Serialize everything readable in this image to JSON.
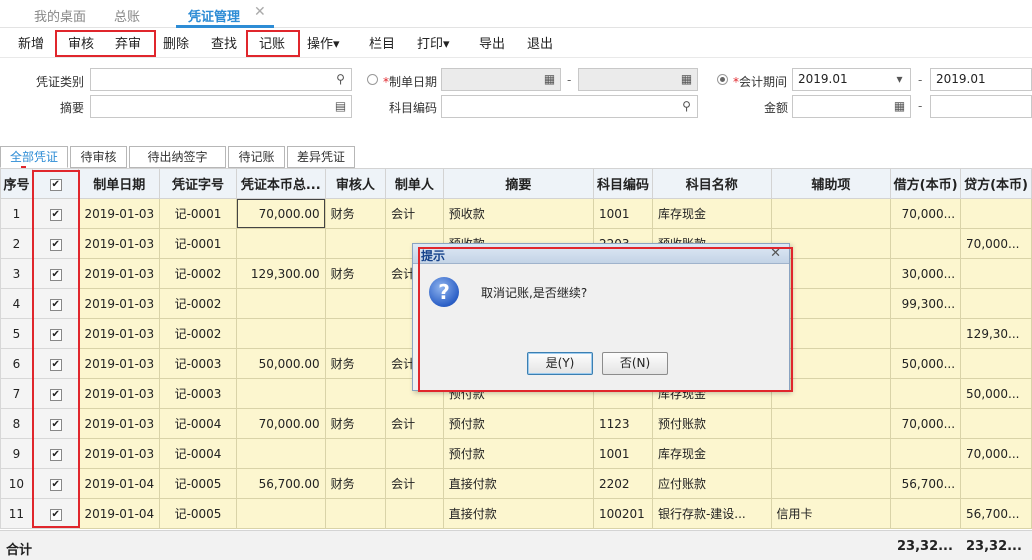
{
  "tabs": [
    {
      "label": "我的桌面"
    },
    {
      "label": "总账"
    },
    {
      "label": "凭证管理",
      "active": true
    }
  ],
  "tab_close": "✕",
  "toolbar": {
    "add": "新增",
    "audit": "审核",
    "unaudit": "弃审",
    "delete": "删除",
    "find": "查找",
    "post": "记账",
    "operate": "操作",
    "columns": "栏目",
    "print": "打印",
    "export": "导出",
    "exit": "退出",
    "caret": "▾"
  },
  "filters": {
    "voucher_type_label": "凭证类别",
    "voucher_type_value": "",
    "summary_label": "摘要",
    "summary_value": "",
    "make_date_label": "制单日期",
    "make_date_from": "",
    "make_date_to": "",
    "account_code_label": "科目编码",
    "account_code_value": "",
    "period_label": "会计期间",
    "period_from": "2019.01",
    "period_to": "2019.01",
    "amount_label": "金额",
    "amount_from": "",
    "amount_to": "",
    "period_selected": true,
    "required_mark": "*",
    "range_dash": "-"
  },
  "filter_tabs": [
    "全部凭证",
    "待审核",
    "待出纳签字",
    "待记账",
    "差异凭证"
  ],
  "grid": {
    "columns": [
      "序号",
      "",
      "制单日期",
      "凭证字号",
      "凭证本币总...",
      "审核人",
      "制单人",
      "摘要",
      "科目编码",
      "科目名称",
      "辅助项",
      "借方(本币)",
      "贷方(本币)"
    ],
    "rows": [
      {
        "seq": "1",
        "checked": true,
        "date": "2019-01-03",
        "no": "记-0001",
        "total": "70,000.00",
        "auditor": "财务",
        "maker": "会计",
        "summary": "预收款",
        "code": "1001",
        "name": "库存现金",
        "aux": "",
        "debit": "70,000...",
        "credit": ""
      },
      {
        "seq": "2",
        "checked": true,
        "date": "2019-01-03",
        "no": "记-0001",
        "total": "",
        "auditor": "",
        "maker": "",
        "summary": "预收款",
        "code": "2203",
        "name": "预收账款",
        "aux": "",
        "debit": "",
        "credit": "70,000..."
      },
      {
        "seq": "3",
        "checked": true,
        "date": "2019-01-03",
        "no": "记-0002",
        "total": "129,300.00",
        "auditor": "财务",
        "maker": "会计",
        "summary": "",
        "code": "",
        "name": "",
        "aux": "款",
        "debit": "30,000...",
        "credit": ""
      },
      {
        "seq": "4",
        "checked": true,
        "date": "2019-01-03",
        "no": "记-0002",
        "total": "",
        "auditor": "",
        "maker": "",
        "summary": "",
        "code": "",
        "name": "",
        "aux": "",
        "debit": "99,300...",
        "credit": ""
      },
      {
        "seq": "5",
        "checked": true,
        "date": "2019-01-03",
        "no": "记-0002",
        "total": "",
        "auditor": "",
        "maker": "",
        "summary": "",
        "code": "",
        "name": "",
        "aux": "",
        "debit": "",
        "credit": "129,30..."
      },
      {
        "seq": "6",
        "checked": true,
        "date": "2019-01-03",
        "no": "记-0003",
        "total": "50,000.00",
        "auditor": "财务",
        "maker": "会计",
        "summary": "",
        "code": "",
        "name": "",
        "aux": "",
        "debit": "50,000...",
        "credit": ""
      },
      {
        "seq": "7",
        "checked": true,
        "date": "2019-01-03",
        "no": "记-0003",
        "total": "",
        "auditor": "",
        "maker": "",
        "summary": "预付款",
        "code": "",
        "name": "库存现金",
        "aux": "",
        "debit": "",
        "credit": "50,000..."
      },
      {
        "seq": "8",
        "checked": true,
        "date": "2019-01-03",
        "no": "记-0004",
        "total": "70,000.00",
        "auditor": "财务",
        "maker": "会计",
        "summary": "预付款",
        "code": "1123",
        "name": "预付账款",
        "aux": "",
        "debit": "70,000...",
        "credit": ""
      },
      {
        "seq": "9",
        "checked": true,
        "date": "2019-01-03",
        "no": "记-0004",
        "total": "",
        "auditor": "",
        "maker": "",
        "summary": "预付款",
        "code": "1001",
        "name": "库存现金",
        "aux": "",
        "debit": "",
        "credit": "70,000..."
      },
      {
        "seq": "10",
        "checked": true,
        "date": "2019-01-04",
        "no": "记-0005",
        "total": "56,700.00",
        "auditor": "财务",
        "maker": "会计",
        "summary": "直接付款",
        "code": "2202",
        "name": "应付账款",
        "aux": "",
        "debit": "56,700...",
        "credit": ""
      },
      {
        "seq": "11",
        "checked": true,
        "date": "2019-01-04",
        "no": "记-0005",
        "total": "",
        "auditor": "",
        "maker": "",
        "summary": "直接付款",
        "code": "100201",
        "name": "银行存款-建设...",
        "aux": "信用卡",
        "debit": "",
        "credit": "56,700..."
      }
    ]
  },
  "footer": {
    "label": "合计",
    "debit_total": "23,32...",
    "credit_total": "23,32..."
  },
  "dialog": {
    "title": "提示",
    "close": "✕",
    "message": "取消记账,是否继续?",
    "icon": "?",
    "yes": "是(Y)",
    "no": "否(N)"
  },
  "checkmark": "✔"
}
